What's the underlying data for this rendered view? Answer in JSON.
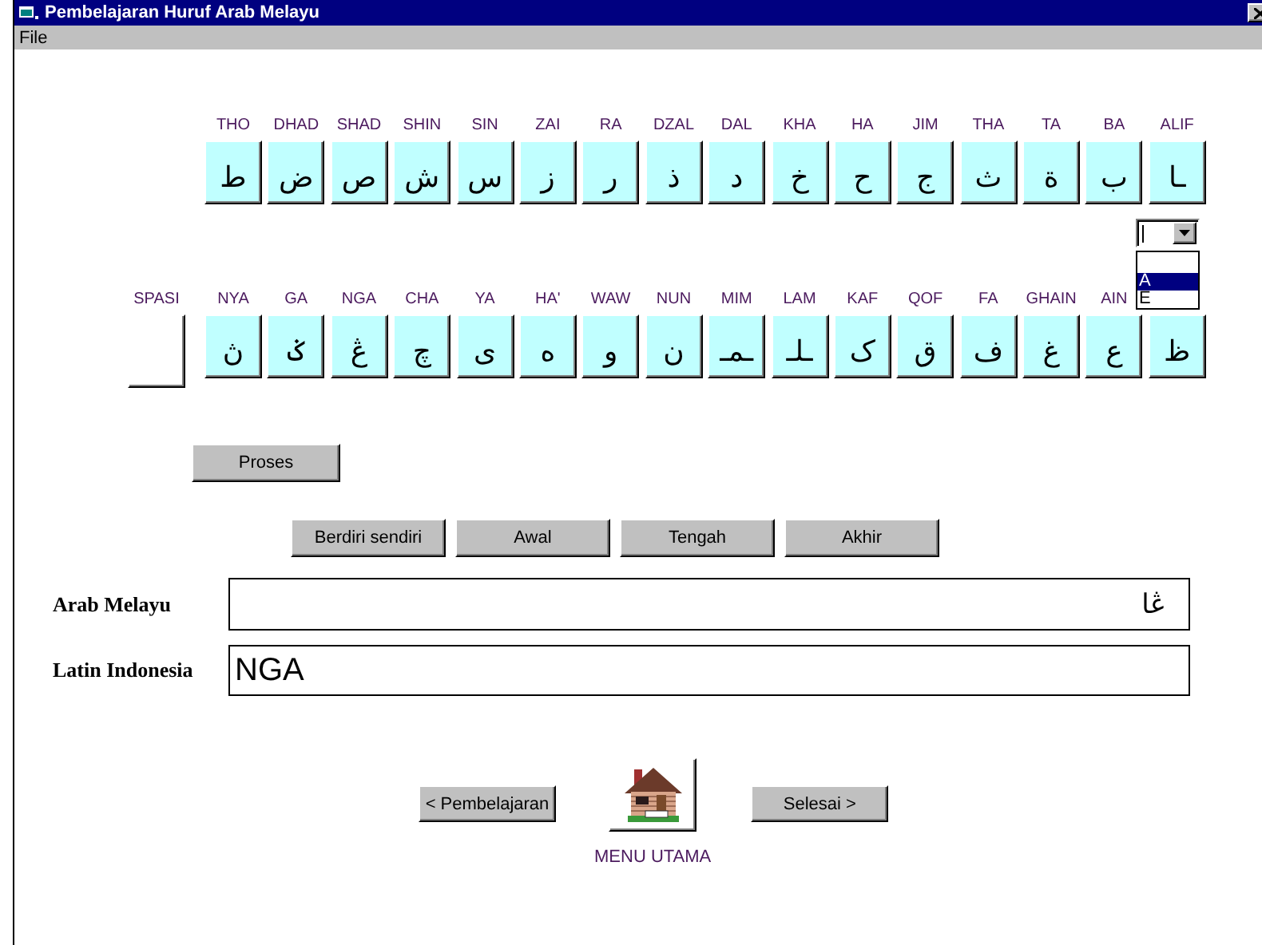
{
  "window": {
    "title": "Pembelajaran Huruf Arab Melayu"
  },
  "menu": [
    {
      "label": "File"
    }
  ],
  "letter_rows": [
    {
      "labels": [
        "THO",
        "DHAD",
        "SHAD",
        "SHIN",
        "SIN",
        "ZAI",
        "RA",
        "DZAL",
        "DAL",
        "KHA",
        "HA",
        "JIM",
        "THA",
        "TA",
        "BA",
        "ALIF"
      ],
      "keys": [
        {
          "kind": "letter",
          "glyph": "ـا"
        },
        {
          "kind": "letter",
          "glyph": "ب"
        },
        {
          "kind": "letter",
          "glyph": "ة"
        },
        {
          "kind": "letter",
          "glyph": "ث"
        },
        {
          "kind": "letter",
          "glyph": "ج"
        },
        {
          "kind": "letter",
          "glyph": "ح"
        },
        {
          "kind": "letter",
          "glyph": "خ"
        },
        {
          "kind": "letter",
          "glyph": "د"
        },
        {
          "kind": "letter",
          "glyph": "ذ"
        },
        {
          "kind": "letter",
          "glyph": "ر"
        },
        {
          "kind": "letter",
          "glyph": "ز"
        },
        {
          "kind": "letter",
          "glyph": "س"
        },
        {
          "kind": "letter",
          "glyph": "ش"
        },
        {
          "kind": "letter",
          "glyph": "ص"
        },
        {
          "kind": "letter",
          "glyph": "ض"
        },
        {
          "kind": "letter",
          "glyph": "ط"
        }
      ]
    },
    {
      "labels": [
        "SPASI",
        "NYA",
        "GA",
        "NGA",
        "CHA",
        "YA",
        "HA'",
        "WAW",
        "NUN",
        "MIM",
        "LAM",
        "KAF",
        "QOF",
        "FA",
        "GHAIN",
        "AIN"
      ],
      "keys": [
        {
          "kind": "letter",
          "glyph": "ظ"
        },
        {
          "kind": "letter",
          "glyph": "ع"
        },
        {
          "kind": "letter",
          "glyph": "غ"
        },
        {
          "kind": "letter",
          "glyph": "ف"
        },
        {
          "kind": "letter",
          "glyph": "ق"
        },
        {
          "kind": "letter",
          "glyph": "ک"
        },
        {
          "kind": "letter",
          "glyph": "ـلـ"
        },
        {
          "kind": "letter",
          "glyph": "ـمـ"
        },
        {
          "kind": "letter",
          "glyph": "ن"
        },
        {
          "kind": "letter",
          "glyph": "و"
        },
        {
          "kind": "letter",
          "glyph": "ه"
        },
        {
          "kind": "letter",
          "glyph": "ى"
        },
        {
          "kind": "letter",
          "glyph": "چ"
        },
        {
          "kind": "letter",
          "glyph": "ڠ"
        },
        {
          "kind": "letter",
          "glyph": "ݢ"
        },
        {
          "kind": "letter",
          "glyph": "ڽ"
        },
        {
          "kind": "space"
        }
      ]
    }
  ],
  "vowel_dropdown": {
    "expanded": true,
    "options": [
      {
        "label": "A",
        "selected": true
      },
      {
        "label": "E",
        "selected": false
      }
    ]
  },
  "process_button": "Proses",
  "position_buttons": [
    "Berdiri sendiri",
    "Awal",
    "Tengah",
    "Akhir"
  ],
  "fields": [
    {
      "kind": "arabic",
      "label": "Arab Melayu",
      "value": "ڠا"
    },
    {
      "kind": "latin",
      "label": "Latin Indonesia",
      "value": "NGA"
    }
  ],
  "navigation": {
    "back": "< Pembelajaran",
    "home_label": "MENU UTAMA",
    "next": "Selesai >"
  }
}
